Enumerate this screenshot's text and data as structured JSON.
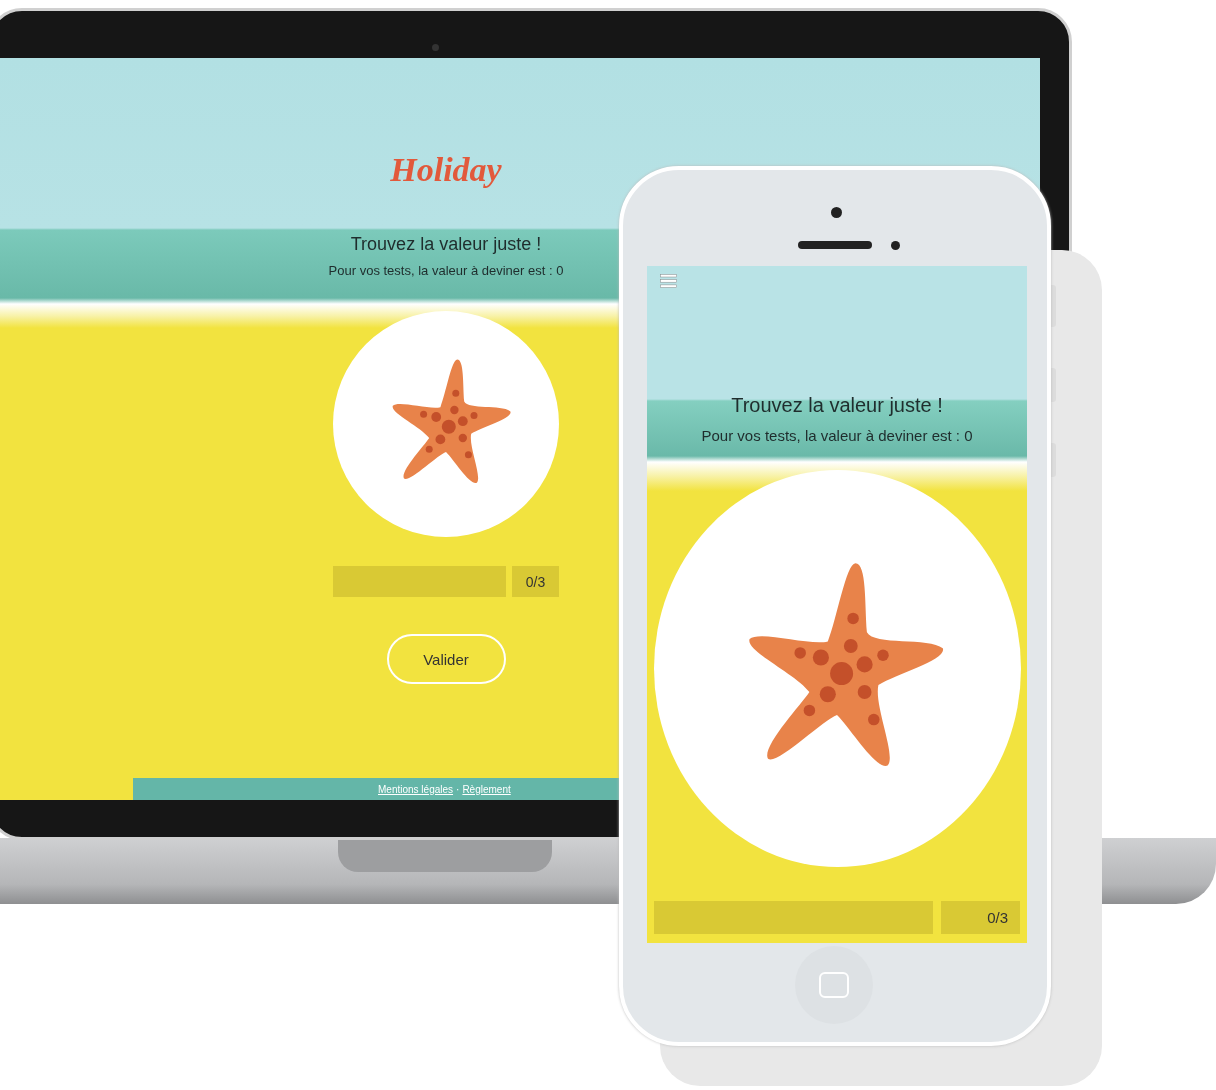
{
  "laptop_screen": {
    "logo": "Holiday",
    "title": "Trouvez la valeur juste !",
    "subtitle": "Pour vos tests, la valeur à deviner est : 0",
    "guess": {
      "counter": "0/3"
    },
    "button": "Valider",
    "footer": {
      "links": [
        "Mentions légales",
        "Règlement"
      ],
      "separator": "·"
    }
  },
  "phone_screen": {
    "title": "Trouvez la valeur juste !",
    "subtitle": "Pour vos tests, la valeur à deviner est : 0",
    "guess": {
      "counter": "0/3"
    }
  }
}
